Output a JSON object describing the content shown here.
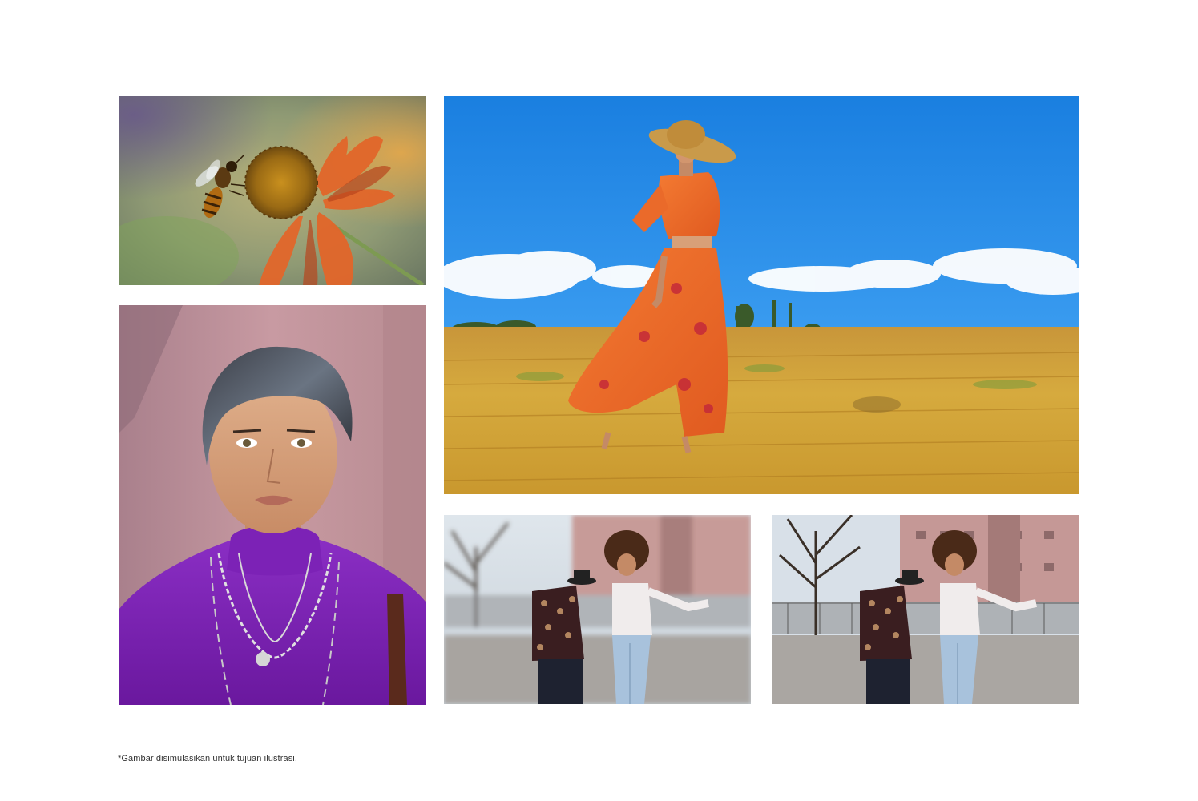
{
  "photos": [
    {
      "id": "bee",
      "subject": "bee on orange flower"
    },
    {
      "id": "portrait",
      "subject": "portrait of person in purple turtleneck"
    },
    {
      "id": "field",
      "subject": "woman in orange floral outfit in wheat field"
    },
    {
      "id": "couple-blur",
      "subject": "dancing couple with blurred background"
    },
    {
      "id": "couple-sharp",
      "subject": "dancing couple with sharp background"
    }
  ],
  "footer": {
    "disclaimer": "*Gambar disimulasikan untuk tujuan ilustrasi."
  },
  "colors": {
    "sky": "#1a86e3",
    "wheat": "#d7a83c",
    "dress": "#f0692a",
    "purple": "#7a1fb0",
    "wall_pink": "#c89aa2"
  }
}
